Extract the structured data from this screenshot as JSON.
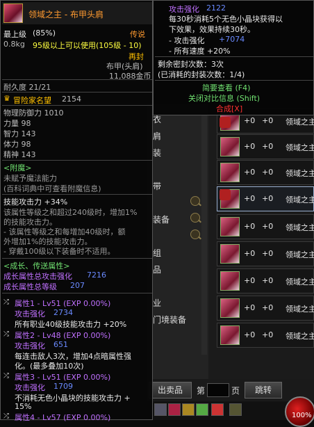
{
  "main_tip": {
    "title": "领域之主 - 布甲头肩",
    "level_label": "最上级",
    "level_pct": "(85%)",
    "rarity": "传说",
    "weight": "0.8kg",
    "req": "95级以上可以使用(105级 - 10)",
    "sealed": "再封",
    "type": "布甲(头肩)",
    "price": "11,088金币",
    "durability": "耐久度 21/21",
    "fame_label": "冒险家名望",
    "fame_value": "2154",
    "phys_def": "物理防御力 1010",
    "str": "力量 98",
    "int": "智力 143",
    "vit": "体力 98",
    "spi": "精神 143",
    "enchant_header": "<附魔>",
    "enchant_l1": "未赋予魔法能力",
    "enchant_l2": "(百科词典中可查看附魔信息)",
    "skill_atk": "技能攻击力 +34%",
    "skill_d1": "该属性等级之和超过240级时，增加1%",
    "skill_d2": "的技能攻击力。",
    "skill_d3": "- 该属性等级之和每增加40级时，额",
    "skill_d4": "外增加1%的技能攻击力。",
    "skill_d5": "- 穿戴100级以下装备时不适用。",
    "growth_header": "<成长、传送属性>",
    "growth_atk_label": "成长属性总攻击强化",
    "growth_atk_value": "7216",
    "growth_lv_label": "成长属性总等级",
    "growth_lv_value": "207",
    "attr1": "属性1 - Lv51 (EXP 0.00%)",
    "attr1_atk_label": "攻击强化",
    "attr1_atk": "2734",
    "attr1_eff": "所有职业40级技能攻击力 +20%",
    "attr2": "属性2 - Lv48 (EXP 0.00%)",
    "attr2_atk_label": "攻击强化",
    "attr2_atk": "651",
    "attr2_eff1": "每连击敌人3次，增加4点暗属性强",
    "attr2_eff2": "化。(最多叠加10次)",
    "attr3": "属性3 - Lv51 (EXP 0.00%)",
    "attr3_atk_label": "攻击强化",
    "attr3_atk": "1709",
    "attr3_eff1": "不消耗无色小晶块的技能攻击力 +",
    "attr3_eff2": "15%",
    "attr4": "属性4 - Lv57 (EXP 0.00%)"
  },
  "side_tip": {
    "atk_label": "攻击强化",
    "atk_value": "2122",
    "d1": "每30秒消耗5个无色小晶块获得以",
    "d2": "下效果，效果持续30秒。",
    "e1_label": "- 攻击强化",
    "e1_value": "+7074",
    "e2": "- 所有速度 +20%",
    "seal_remain": "剩余密封次数：3次",
    "seal_used": "(已消耗的封装次数：1/4)",
    "brief": "简要查看 (F4)",
    "close": "关闭对比信息 (Shift)",
    "combine": "合成[X]"
  },
  "list": {
    "rows": [
      {
        "v1": "+0",
        "v2": "+0",
        "name": "领域之主"
      },
      {
        "v1": "+0",
        "v2": "+0",
        "name": "领域之主"
      },
      {
        "v1": "+0",
        "v2": "+0",
        "name": "领域之主"
      },
      {
        "v1": "+0",
        "v2": "+0",
        "name": "领域之主"
      },
      {
        "v1": "+0",
        "v2": "+0",
        "name": "领域之主"
      },
      {
        "v1": "+0",
        "v2": "+0",
        "name": "领域之主"
      },
      {
        "v1": "+0",
        "v2": "+0",
        "name": "领域之主"
      },
      {
        "v1": "+0",
        "v2": "+0",
        "name": "领域之主"
      },
      {
        "v1": "+0",
        "v2": "+0",
        "name": "领域之主"
      }
    ],
    "mid_items": [
      "衣",
      "肩",
      "装",
      "带",
      "装备",
      "组",
      "品",
      "业",
      "门境装备"
    ]
  },
  "bottom": {
    "sell_label": "出卖品",
    "page_prefix": "第",
    "page_suffix": "页",
    "jump_label": "跳转",
    "orb_value": "100%"
  }
}
